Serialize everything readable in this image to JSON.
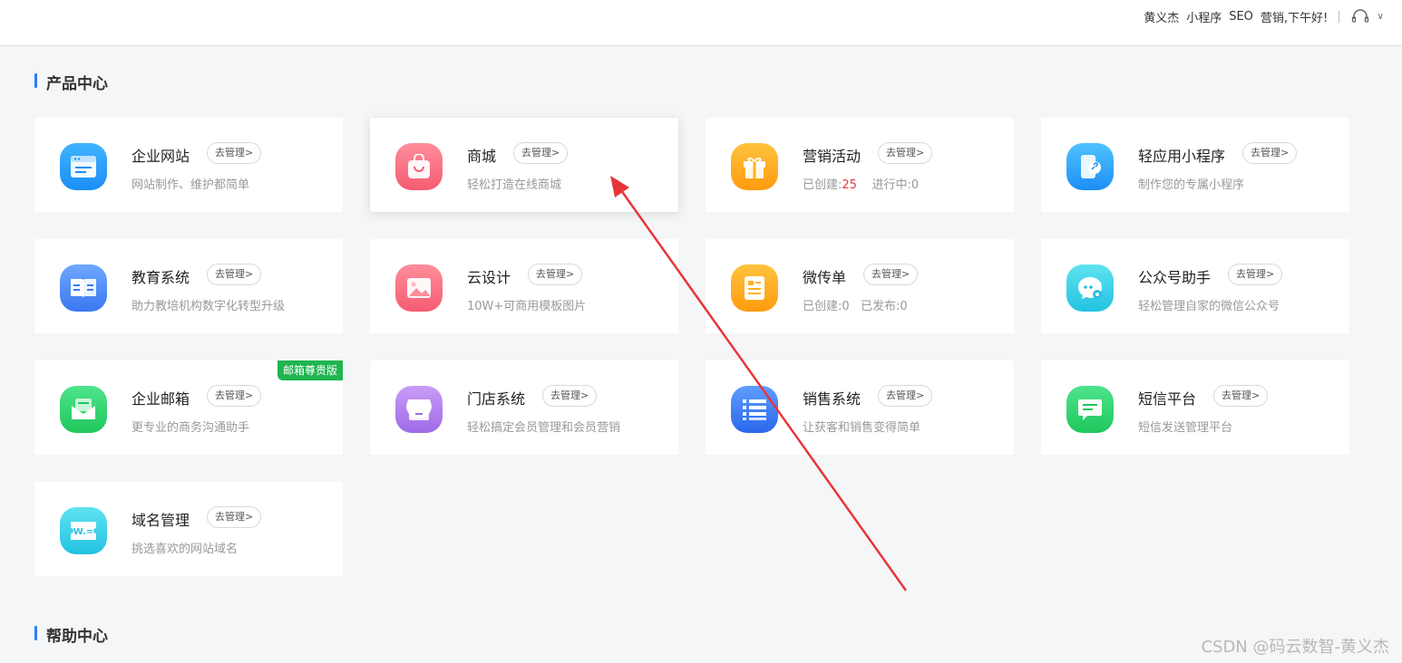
{
  "header": {
    "user_name": "黄义杰",
    "mini_program": "小程序",
    "seo": "SEO",
    "greeting": "营销,下午好!",
    "separator": "|",
    "chevron": "∨"
  },
  "sections": {
    "products_title": "产品中心",
    "help_title": "帮助中心"
  },
  "cards": [
    {
      "name": "企业网站",
      "manage": "去管理>",
      "desc": "网站制作、维护都简单",
      "icon": "website-icon",
      "color": "#1a8ff5"
    },
    {
      "name": "商城",
      "manage": "去管理>",
      "desc": "轻松打造在线商城",
      "icon": "shopping-bag-icon",
      "color": "#f55c72"
    },
    {
      "name": "营销活动",
      "manage": "去管理>",
      "desc_prefix": "已创建:",
      "desc_count": "25",
      "desc_suffix": "进行中:0",
      "icon": "gift-icon",
      "color": "#ff9b0f"
    },
    {
      "name": "轻应用小程序",
      "manage": "去管理>",
      "desc": "制作您的专属小程序",
      "icon": "mini-program-icon",
      "color": "#1d8ff5"
    },
    {
      "name": "教育系统",
      "manage": "去管理>",
      "desc": "助力教培机构数字化转型升级",
      "icon": "book-icon",
      "color": "#3b78f0"
    },
    {
      "name": "云设计",
      "manage": "去管理>",
      "desc": "10W+可商用模板图片",
      "icon": "image-icon",
      "color": "#f55c72"
    },
    {
      "name": "微传单",
      "manage": "去管理>",
      "desc": "已创建:0   已发布:0",
      "icon": "flyer-icon",
      "color": "#ff9b0f"
    },
    {
      "name": "公众号助手",
      "manage": "去管理>",
      "desc": "轻松管理自家的微信公众号",
      "icon": "wechat-chat-icon",
      "color": "#24c2e3"
    },
    {
      "name": "企业邮箱",
      "manage": "去管理>",
      "desc": "更专业的商务沟通助手",
      "icon": "mail-icon",
      "color": "#1fc75c",
      "badge": "邮箱尊贵版"
    },
    {
      "name": "门店系统",
      "manage": "去管理>",
      "desc": "轻松搞定会员管理和会员营销",
      "icon": "store-icon",
      "color": "#9f6ae8"
    },
    {
      "name": "销售系统",
      "manage": "去管理>",
      "desc": "让获客和销售变得简单",
      "icon": "list-icon",
      "color": "#2a67ec"
    },
    {
      "name": "短信平台",
      "manage": "去管理>",
      "desc": "短信发送管理平台",
      "icon": "sms-icon",
      "color": "#1fc75c"
    },
    {
      "name": "域名管理",
      "manage": "去管理>",
      "desc": "挑选喜欢的网站域名",
      "icon": "domain-icon",
      "color": "#24c2e3",
      "icon_text": "W.="
    }
  ],
  "watermark": "CSDN @码云数智-黄义杰",
  "annotation_color": "#e8353a"
}
